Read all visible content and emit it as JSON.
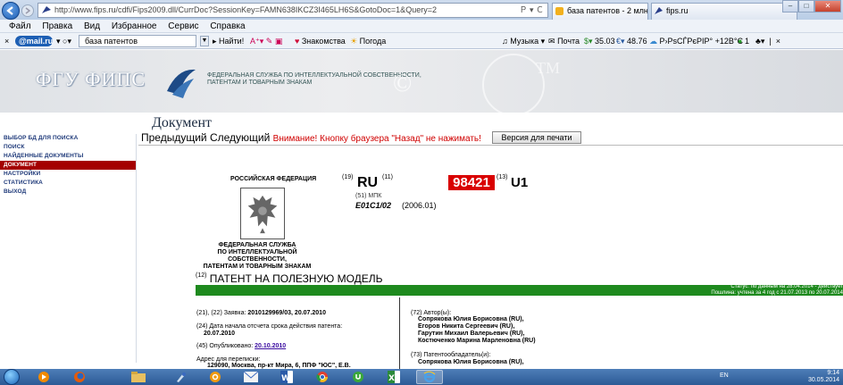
{
  "browser": {
    "url": "http://www.fips.ru/cdfi/Fips2009.dll/CurrDoc?SessionKey=FAMN638IKCZ3I465LH6S&GotoDoc=1&Query=2",
    "url_tools": "Ｐ ▾ Ｃ",
    "tabs": [
      {
        "title": "база патентов - 2 млн ..."
      },
      {
        "title": "fips.ru"
      }
    ],
    "window_controls": [
      "‒",
      "□",
      "✕"
    ]
  },
  "menu": [
    "Файл",
    "Правка",
    "Вид",
    "Избранное",
    "Сервис",
    "Справка"
  ],
  "toolbar": {
    "mailru": "mail.ru",
    "search_value": "база патентов",
    "find": "Найти!",
    "friends": "Знакомства",
    "weather": "Погода",
    "music": "Музыка",
    "mail": "Почта",
    "usd": "35.03",
    "eur": "48.76",
    "city": "Р›РѕСЃРєРІР° +12В°C",
    "counter": "1"
  },
  "site": {
    "logo": "ФГУ ФИПС",
    "org_line1": "ФЕДЕРАЛЬНАЯ СЛУЖБА ПО ИНТЕЛЛЕКТУАЛЬНОЙ СОБСТВЕННОСТИ,",
    "org_line2": "ПАТЕНТАМ И ТОВАРНЫМ ЗНАКАМ",
    "deco1": "©",
    "deco2": "TM"
  },
  "page": {
    "title": "Документ",
    "prev": "Предыдущий",
    "next": "Следующий",
    "warning": "Внимание! Кнопку браузера \"Назад\" не нажимать!",
    "print": "Версия для печати"
  },
  "sidebar": {
    "items": [
      {
        "label": "Выбор БД для поиска",
        "active": false
      },
      {
        "label": "Поиск",
        "active": false
      },
      {
        "label": "Найденные документы",
        "active": false
      },
      {
        "label": "Документ",
        "active": true
      },
      {
        "label": "Настройки",
        "active": false
      },
      {
        "label": "Статистика",
        "active": false
      },
      {
        "label": "Выход",
        "active": false
      }
    ]
  },
  "patent": {
    "country_label": "РОССИЙСКАЯ ФЕДЕРАЦИЯ",
    "code19": "(19)",
    "country": "RU",
    "code11": "(11)",
    "number": "98421",
    "code13": "(13)",
    "kind": "U1",
    "mpk_label": "(51) МПК",
    "mpk": "E01C1/02",
    "mpk_version": "(2006.01)",
    "service_lines": [
      "ФЕДЕРАЛЬНАЯ СЛУЖБА",
      "ПО ИНТЕЛЛЕКТУАЛЬНОЙ",
      "СОБСТВЕННОСТИ,",
      "ПАТЕНТАМ И ТОВАРНЫМ ЗНАКАМ"
    ],
    "code12": "(12)",
    "type": "ПАТЕНТ НА ПОЛЕЗНУЮ МОДЕЛЬ",
    "status_line1": "Статус: по данным на 28.04.2014 - действует",
    "status_line2": "Пошлина: учтена за 4 год с 21.07.2013 по 20.07.2014",
    "application_label": "(21), (22) Заявка:",
    "application": "2010129969/03, 20.07.2010",
    "term_label": "(24) Дата начала отсчета срока действия патента:",
    "term_date": "20.07.2010",
    "published_label": "(45) Опубликовано:",
    "published": "20.10.2010",
    "address_label": "Адрес для переписки:",
    "address": "129090, Москва, пр-кт Мира, 6, ППФ \"ЮС\", Е.В.",
    "authors_label": "(72) Автор(ы):",
    "authors": [
      "Сопрякова Юлия Борисовна (RU),",
      "Егоров Никита Сергеевич (RU),",
      "Гарутин Михаил Валерьевич (RU),",
      "Костюченко Марина Марленовна (RU)"
    ],
    "owners_label": "(73) Патентообладатель(и):",
    "owners": [
      "Сопрякова Юлия Борисовна (RU),"
    ]
  },
  "taskbar": {
    "lang": "EN",
    "time": "9:14",
    "date": "30.05.2014"
  },
  "colors": {
    "accent_red": "#d90000",
    "status_green": "#1e8a1e",
    "nav_blue": "#1f3a7a"
  }
}
